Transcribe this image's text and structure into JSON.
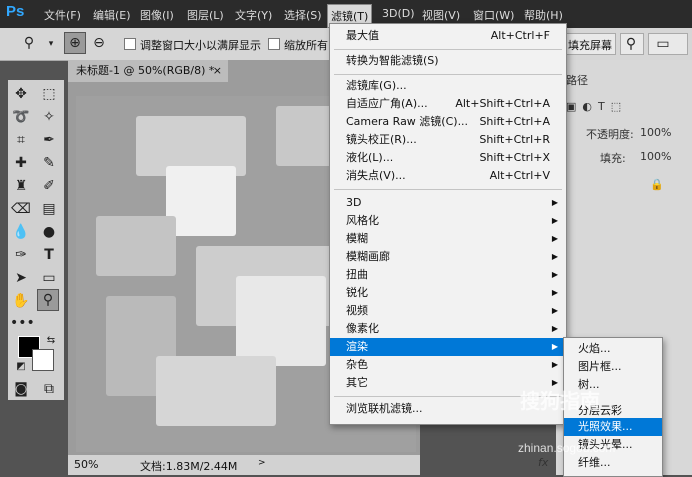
{
  "menubar": {
    "logo": "Ps",
    "items": [
      "文件(F)",
      "编辑(E)",
      "图像(I)",
      "图层(L)",
      "文字(Y)",
      "选择(S)",
      "滤镜(T)",
      "3D(D)",
      "视图(V)",
      "窗口(W)",
      "帮助(H)"
    ]
  },
  "optionsbar": {
    "resize_windows": "调整窗口大小以满屏显示",
    "zoom_all": "缩放所有",
    "fill_screen": "填充屏幕"
  },
  "document": {
    "tab_title": "未标题-1 @ 50%(RGB/8) *",
    "tab_close": "×",
    "zoom": "50%",
    "doc_size": "文档:1.83M/2.44M"
  },
  "rightpanel": {
    "tab_label": "路径",
    "opacity_label": "不透明度:",
    "opacity_value": "100%",
    "fill_label": "填充:",
    "fill_value": "100%"
  },
  "filter_menu": {
    "items": [
      {
        "label": "最大值",
        "shortcut": "Alt+Ctrl+F"
      },
      {
        "label": "转换为智能滤镜(S)",
        "shortcut": ""
      },
      {
        "label": "滤镜库(G)...",
        "shortcut": ""
      },
      {
        "label": "自适应广角(A)...",
        "shortcut": "Alt+Shift+Ctrl+A"
      },
      {
        "label": "Camera Raw 滤镜(C)...",
        "shortcut": "Shift+Ctrl+A"
      },
      {
        "label": "镜头校正(R)...",
        "shortcut": "Shift+Ctrl+R"
      },
      {
        "label": "液化(L)...",
        "shortcut": "Shift+Ctrl+X"
      },
      {
        "label": "消失点(V)...",
        "shortcut": "Alt+Ctrl+V"
      },
      {
        "label": "3D",
        "shortcut": ""
      },
      {
        "label": "风格化",
        "shortcut": ""
      },
      {
        "label": "模糊",
        "shortcut": ""
      },
      {
        "label": "模糊画廊",
        "shortcut": ""
      },
      {
        "label": "扭曲",
        "shortcut": ""
      },
      {
        "label": "锐化",
        "shortcut": ""
      },
      {
        "label": "视频",
        "shortcut": ""
      },
      {
        "label": "像素化",
        "shortcut": ""
      },
      {
        "label": "渲染",
        "shortcut": ""
      },
      {
        "label": "杂色",
        "shortcut": ""
      },
      {
        "label": "其它",
        "shortcut": ""
      },
      {
        "label": "浏览联机滤镜...",
        "shortcut": ""
      }
    ]
  },
  "render_submenu": {
    "items": [
      "火焰...",
      "图片框...",
      "树...",
      "分层云彩",
      "光照效果...",
      "镜头光晕...",
      "纤维..."
    ]
  },
  "watermark": {
    "text": "搜狗指南",
    "url": "zhinan.sogou.com"
  },
  "colors": {
    "highlight": "#0078d7",
    "menubar_bg": "#2b2b2b",
    "workspace_bg": "#535353"
  }
}
